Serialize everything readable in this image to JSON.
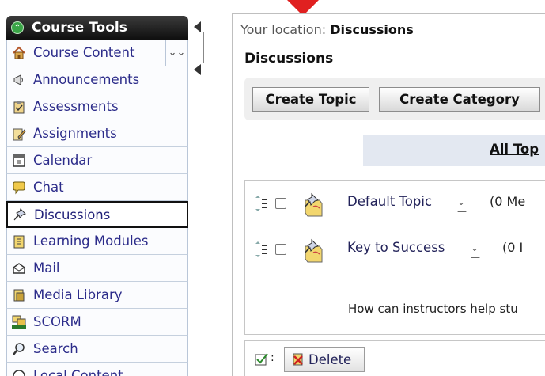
{
  "sidebar": {
    "header": "Course Tools",
    "items": [
      {
        "label": "Course Content",
        "icon": "home-icon"
      },
      {
        "label": "Announcements",
        "icon": "megaphone-icon"
      },
      {
        "label": "Assessments",
        "icon": "clipboard-icon"
      },
      {
        "label": "Assignments",
        "icon": "pencil-doc-icon"
      },
      {
        "label": "Calendar",
        "icon": "calendar-icon"
      },
      {
        "label": "Chat",
        "icon": "chat-icon"
      },
      {
        "label": "Discussions",
        "icon": "pushpin-icon"
      },
      {
        "label": "Learning Modules",
        "icon": "book-icon"
      },
      {
        "label": "Mail",
        "icon": "mail-icon"
      },
      {
        "label": "Media Library",
        "icon": "media-icon"
      },
      {
        "label": "SCORM",
        "icon": "scorm-icon"
      },
      {
        "label": "Search",
        "icon": "magnifier-icon"
      },
      {
        "label": "Local Content",
        "icon": "local-content-icon"
      }
    ],
    "selected": "Discussions"
  },
  "main": {
    "location_prefix": "Your location:",
    "location_value": "Discussions",
    "title": "Discussions",
    "toolbar": {
      "create_topic": "Create Topic",
      "create_category": "Create Category"
    },
    "tab_label": "All Top",
    "topics": [
      {
        "name": "Default Topic",
        "count": "(0 Me"
      },
      {
        "name": "Key to Success",
        "count": "(0 I"
      }
    ],
    "description": "How can instructors help stu",
    "delete_label": "Delete"
  },
  "colors": {
    "accent_red": "#e02020",
    "link": "#23235a",
    "sidebar_header": "#1a1a1a"
  }
}
